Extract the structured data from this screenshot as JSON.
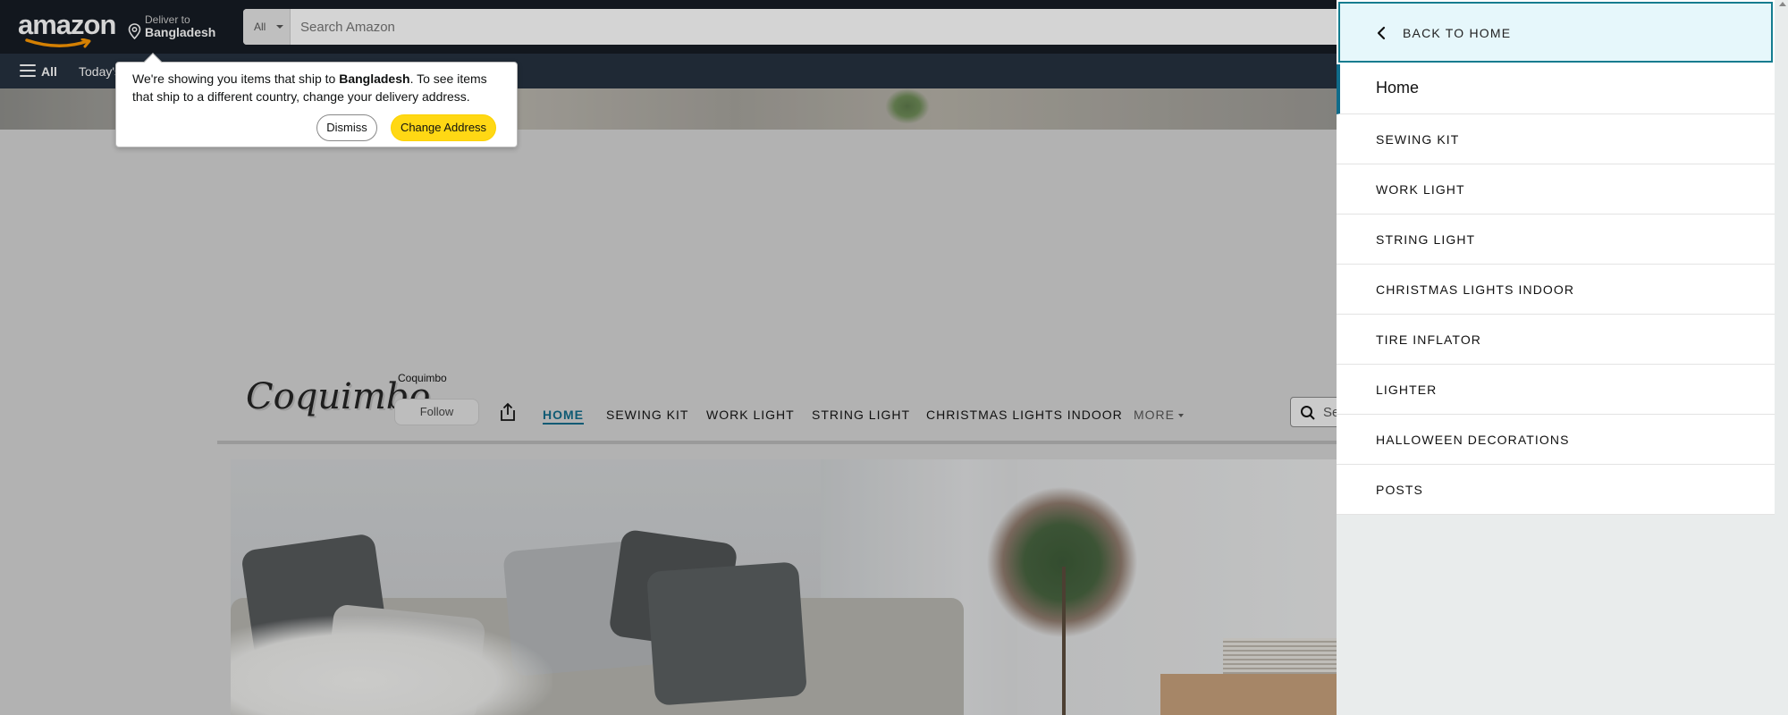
{
  "header": {
    "logo_text": "amazon",
    "deliver_line1": "Deliver to",
    "deliver_line2": "Bangladesh",
    "search_category": "All",
    "search_placeholder": "Search Amazon"
  },
  "subnav": {
    "all_label": "All",
    "todays_label": "Today's"
  },
  "popover": {
    "msg_prefix": "We're showing you items that ship to ",
    "msg_country": "Bangladesh",
    "msg_suffix": ". To see items that ship to a different country, change your delivery address.",
    "dismiss_label": "Dismiss",
    "change_label": "Change Address"
  },
  "store": {
    "logo_text": "Coquimbo",
    "brand_name": "Coquimbo",
    "follow_label": "Follow",
    "nav": [
      {
        "label": "Home",
        "active": true
      },
      {
        "label": "Sewing Kit"
      },
      {
        "label": "Work Light"
      },
      {
        "label": "String Light"
      },
      {
        "label": "Christmas Lights Indoor"
      },
      {
        "label": "More"
      }
    ],
    "search_placeholder": "Se"
  },
  "drawer": {
    "back_label": "Back to Home",
    "home_label": "Home",
    "items": [
      "Sewing Kit",
      "Work Light",
      "String Light",
      "Christmas Lights Indoor",
      "Tire Inflator",
      "Lighter",
      "Halloween Decorations",
      "Posts"
    ]
  },
  "colors": {
    "nav_dark": "#131921",
    "nav_sub": "#232f3e",
    "accent_teal": "#0f6b8a",
    "button_yellow": "#ffd814"
  }
}
